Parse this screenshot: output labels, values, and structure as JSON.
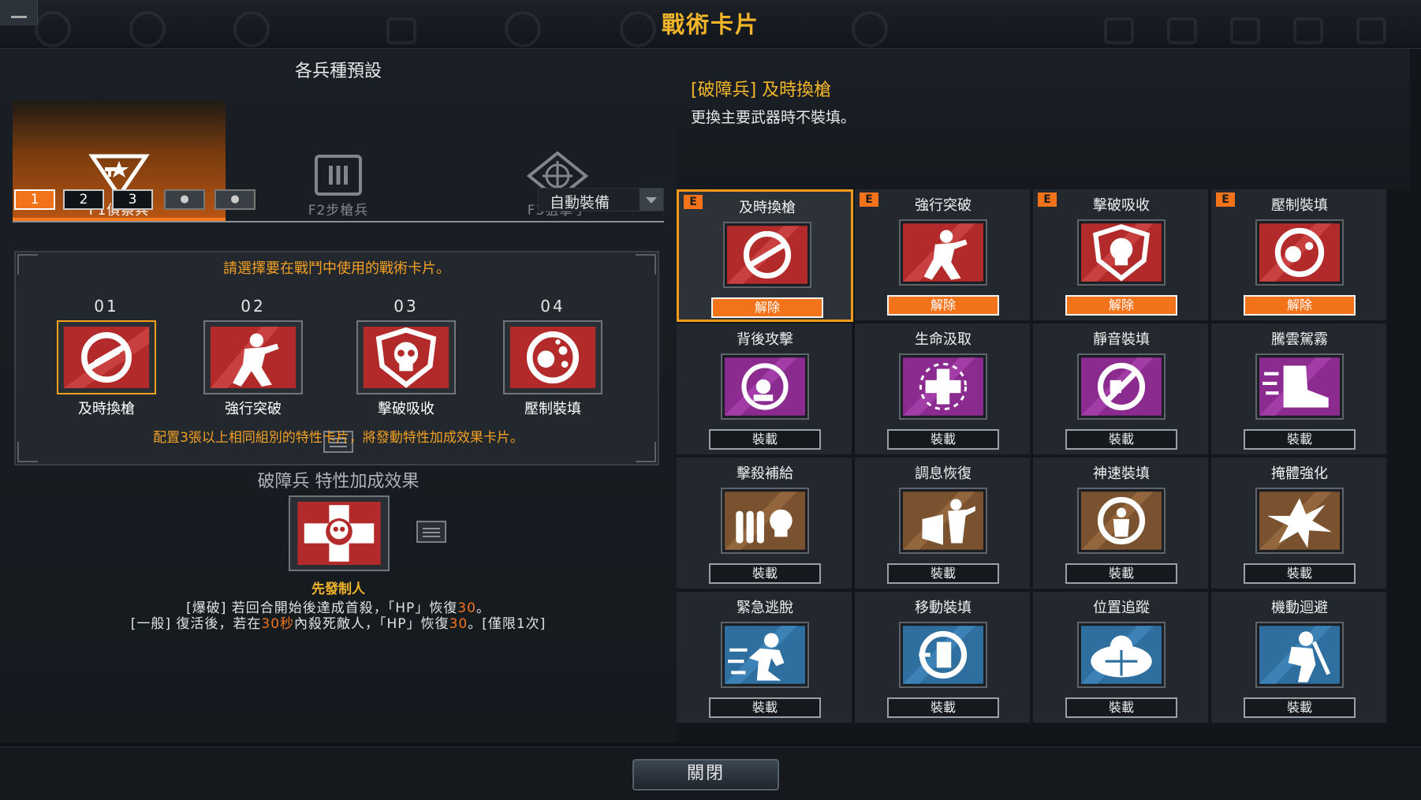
{
  "window": {
    "title": "戰術卡片"
  },
  "colors": {
    "accent": "#f3731b",
    "gold": "#f2b52a",
    "panel": "#23282e"
  },
  "left": {
    "presets_title": "各兵種預設",
    "class_tabs": [
      {
        "label": "F1偵察兵",
        "icon": "scout-star-gun-icon",
        "active": true
      },
      {
        "label": "F2步槍兵",
        "icon": "rifle-ammo-icon",
        "active": false
      },
      {
        "label": "F3狙擊手",
        "icon": "crosshair-icon",
        "active": false
      }
    ],
    "slots": [
      {
        "label": "1",
        "state": "active"
      },
      {
        "label": "2",
        "state": "normal"
      },
      {
        "label": "3",
        "state": "normal"
      },
      {
        "label": "",
        "state": "locked",
        "icon": "lock-icon"
      },
      {
        "label": "",
        "state": "locked",
        "icon": "lock-icon"
      }
    ],
    "auto_equip": "自動裝備",
    "select_prompt": "請選擇要在戰鬥中使用的戰術卡片。",
    "equipped": [
      {
        "num": "01",
        "name": "及時換槍",
        "icon": "quick-swap-icon"
      },
      {
        "num": "02",
        "name": "強行突破",
        "icon": "breach-soldier-icon"
      },
      {
        "num": "03",
        "name": "擊破吸收",
        "icon": "skull-shield-icon"
      },
      {
        "num": "04",
        "name": "壓制裝填",
        "icon": "suppress-reload-icon"
      }
    ],
    "hint": "配置3張以上相同組別的特性卡片，將發動特性加成效果卡片。",
    "bonus_title": "破障兵 特性加成效果",
    "bonus_card_name": "先發制人",
    "bonus_line1": {
      "pre": "[爆破] 若回合開始後達成首殺，「HP」恢復",
      "v1": "30",
      "post": "。"
    },
    "bonus_line2": {
      "pre": "[一般] 復活後，若在",
      "v1": "30秒",
      "mid": "內殺死敵人，「HP」恢復",
      "v2": "30",
      "post": "。[僅限1次]"
    }
  },
  "detail": {
    "name": "[破障兵] 及時換槍",
    "desc": "更換主要武器時不裝填。"
  },
  "cards": [
    {
      "name": "及時換槍",
      "button": "解除",
      "equipped": true,
      "selected": true,
      "theme": "red",
      "icon": "quick-swap-icon"
    },
    {
      "name": "強行突破",
      "button": "解除",
      "equipped": true,
      "selected": false,
      "theme": "red",
      "icon": "breach-soldier-icon"
    },
    {
      "name": "擊破吸收",
      "button": "解除",
      "equipped": true,
      "selected": false,
      "theme": "red",
      "icon": "skull-shield-icon"
    },
    {
      "name": "壓制裝填",
      "button": "解除",
      "equipped": true,
      "selected": false,
      "theme": "red",
      "icon": "suppress-reload-icon"
    },
    {
      "name": "背後攻擊",
      "button": "裝載",
      "equipped": false,
      "selected": false,
      "theme": "purple",
      "icon": "back-attack-icon"
    },
    {
      "name": "生命汲取",
      "button": "裝載",
      "equipped": false,
      "selected": false,
      "theme": "purple",
      "icon": "life-drain-icon"
    },
    {
      "name": "靜音裝填",
      "button": "裝載",
      "equipped": false,
      "selected": false,
      "theme": "purple",
      "icon": "silent-reload-icon"
    },
    {
      "name": "騰雲駕霧",
      "button": "裝載",
      "equipped": false,
      "selected": false,
      "theme": "purple",
      "icon": "boot-dash-icon"
    },
    {
      "name": "擊殺補給",
      "button": "裝載",
      "equipped": false,
      "selected": false,
      "theme": "brown",
      "icon": "ammo-skull-icon"
    },
    {
      "name": "調息恢復",
      "button": "裝載",
      "equipped": false,
      "selected": false,
      "theme": "brown",
      "icon": "recover-shield-icon"
    },
    {
      "name": "神速裝填",
      "button": "裝載",
      "equipped": false,
      "selected": false,
      "theme": "brown",
      "icon": "fast-reload-icon"
    },
    {
      "name": "掩體強化",
      "button": "裝載",
      "equipped": false,
      "selected": false,
      "theme": "brown",
      "icon": "cover-burst-icon"
    },
    {
      "name": "緊急逃脫",
      "button": "裝載",
      "equipped": false,
      "selected": false,
      "theme": "blue",
      "icon": "escape-runner-icon"
    },
    {
      "name": "移動裝填",
      "button": "裝載",
      "equipped": false,
      "selected": false,
      "theme": "blue",
      "icon": "move-reload-icon"
    },
    {
      "name": "位置追蹤",
      "button": "裝載",
      "equipped": false,
      "selected": false,
      "theme": "blue",
      "icon": "tracking-cloud-icon"
    },
    {
      "name": "機動迴避",
      "button": "裝載",
      "equipped": false,
      "selected": false,
      "theme": "blue",
      "icon": "dodge-soldier-icon"
    }
  ],
  "close_button": "關閉"
}
